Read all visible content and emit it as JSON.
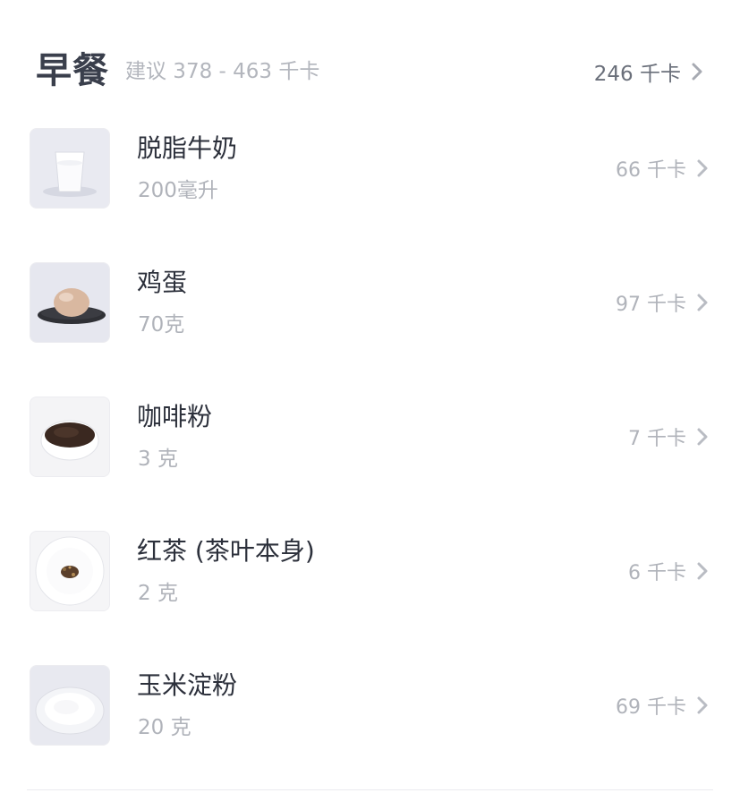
{
  "meal": {
    "title": "早餐",
    "suggestion": "建议 378 - 463 千卡",
    "total": "246 千卡"
  },
  "items": [
    {
      "name": "脱脂牛奶",
      "amount": "200毫升",
      "kcal": "66 千卡",
      "icon": "milk-glass-photo"
    },
    {
      "name": "鸡蛋",
      "amount": "70克",
      "kcal": "97 千卡",
      "icon": "egg-on-plate-photo"
    },
    {
      "name": "咖啡粉",
      "amount": "3 克",
      "kcal": "7 千卡",
      "icon": "coffee-powder-bowl-photo"
    },
    {
      "name": "红茶 (茶叶本身)",
      "amount": "2 克",
      "kcal": "6 千卡",
      "icon": "tea-leaves-plate-photo"
    },
    {
      "name": "玉米淀粉",
      "amount": "20 克",
      "kcal": "69 千卡",
      "icon": "corn-starch-plate-photo"
    }
  ],
  "colors": {
    "title": "#3a3f4c",
    "muted": "#b0b3ba",
    "chevron": "#b9bcc3"
  }
}
